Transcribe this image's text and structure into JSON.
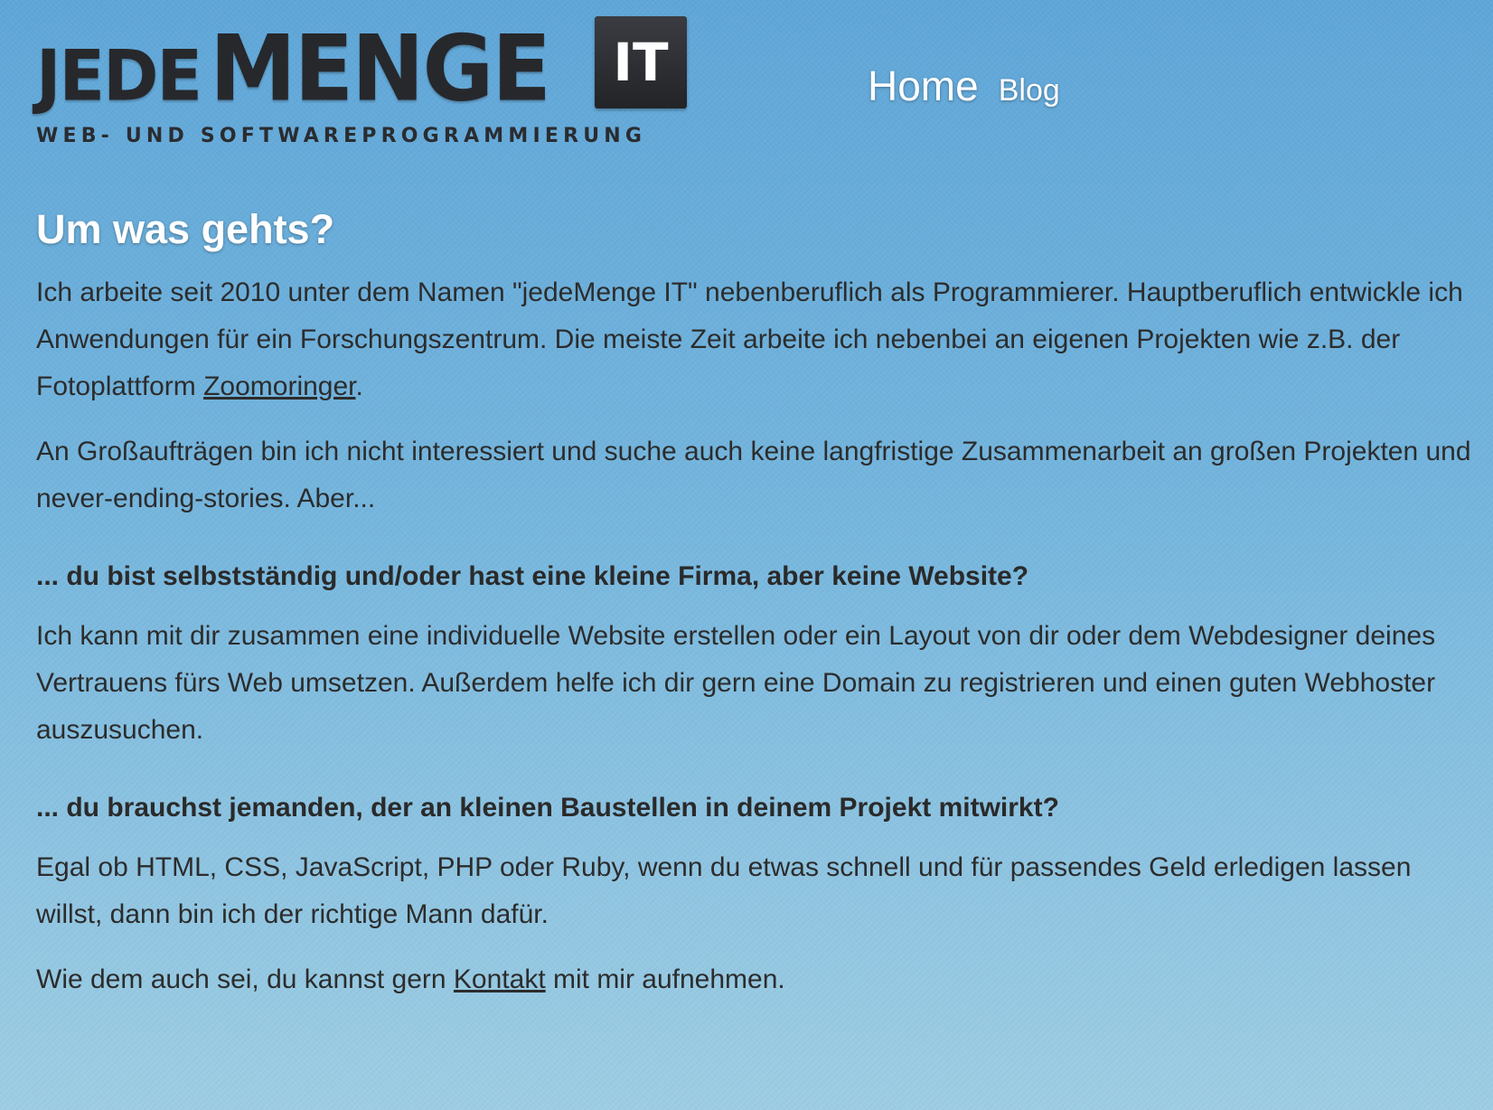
{
  "header": {
    "logo_word_1": "JEDE",
    "logo_word_2": "MENGE",
    "logo_badge": "IT",
    "logo_tagline": "WEB- UND SOFTWAREPROGRAMMIERUNG"
  },
  "nav": {
    "home": "Home",
    "blog": "Blog"
  },
  "main": {
    "heading": "Um was gehts?",
    "intro": {
      "text_before_link": "Ich arbeite seit 2010 unter dem Namen \"jedeMenge IT\" nebenberuflich als Programmierer. Hauptberuflich entwickle ich Anwendungen für ein Forschungszentrum. Die meiste Zeit arbeite ich nebenbei an eigenen Projekten wie z.B. der Fotoplattform ",
      "link": "Zoomoringer",
      "text_after_link": "."
    },
    "paragraph_2": "An Großaufträgen bin ich nicht interessiert und suche auch keine langfristige Zusammenarbeit an großen Projekten und never-ending-stories. Aber...",
    "section_1": {
      "heading": "... du bist selbstständig und/oder hast eine kleine Firma, aber keine Website?",
      "text": "Ich kann mit dir zusammen eine individuelle Website erstellen oder ein Layout von dir oder dem Webdesigner deines Vertrauens fürs Web umsetzen. Außerdem helfe ich dir gern eine Domain zu registrieren und einen guten Webhoster auszusuchen."
    },
    "section_2": {
      "heading": "... du brauchst jemanden, der an kleinen Baustellen in deinem Projekt mitwirkt?",
      "text": "Egal ob HTML, CSS, JavaScript, PHP oder Ruby, wenn du etwas schnell und für passendes Geld erledigen lassen willst, dann bin ich der richtige Mann dafür."
    },
    "closing": {
      "text_before_link": "Wie dem auch sei, du kannst gern ",
      "link": "Kontakt",
      "text_after_link": " mit mir aufnehmen."
    }
  },
  "colors": {
    "background_top": "#5fa6d8",
    "background_bottom": "#9dcde3",
    "heading_text": "#ffffff",
    "body_text": "#2c2c2c",
    "logo_dark": "#26282c"
  }
}
